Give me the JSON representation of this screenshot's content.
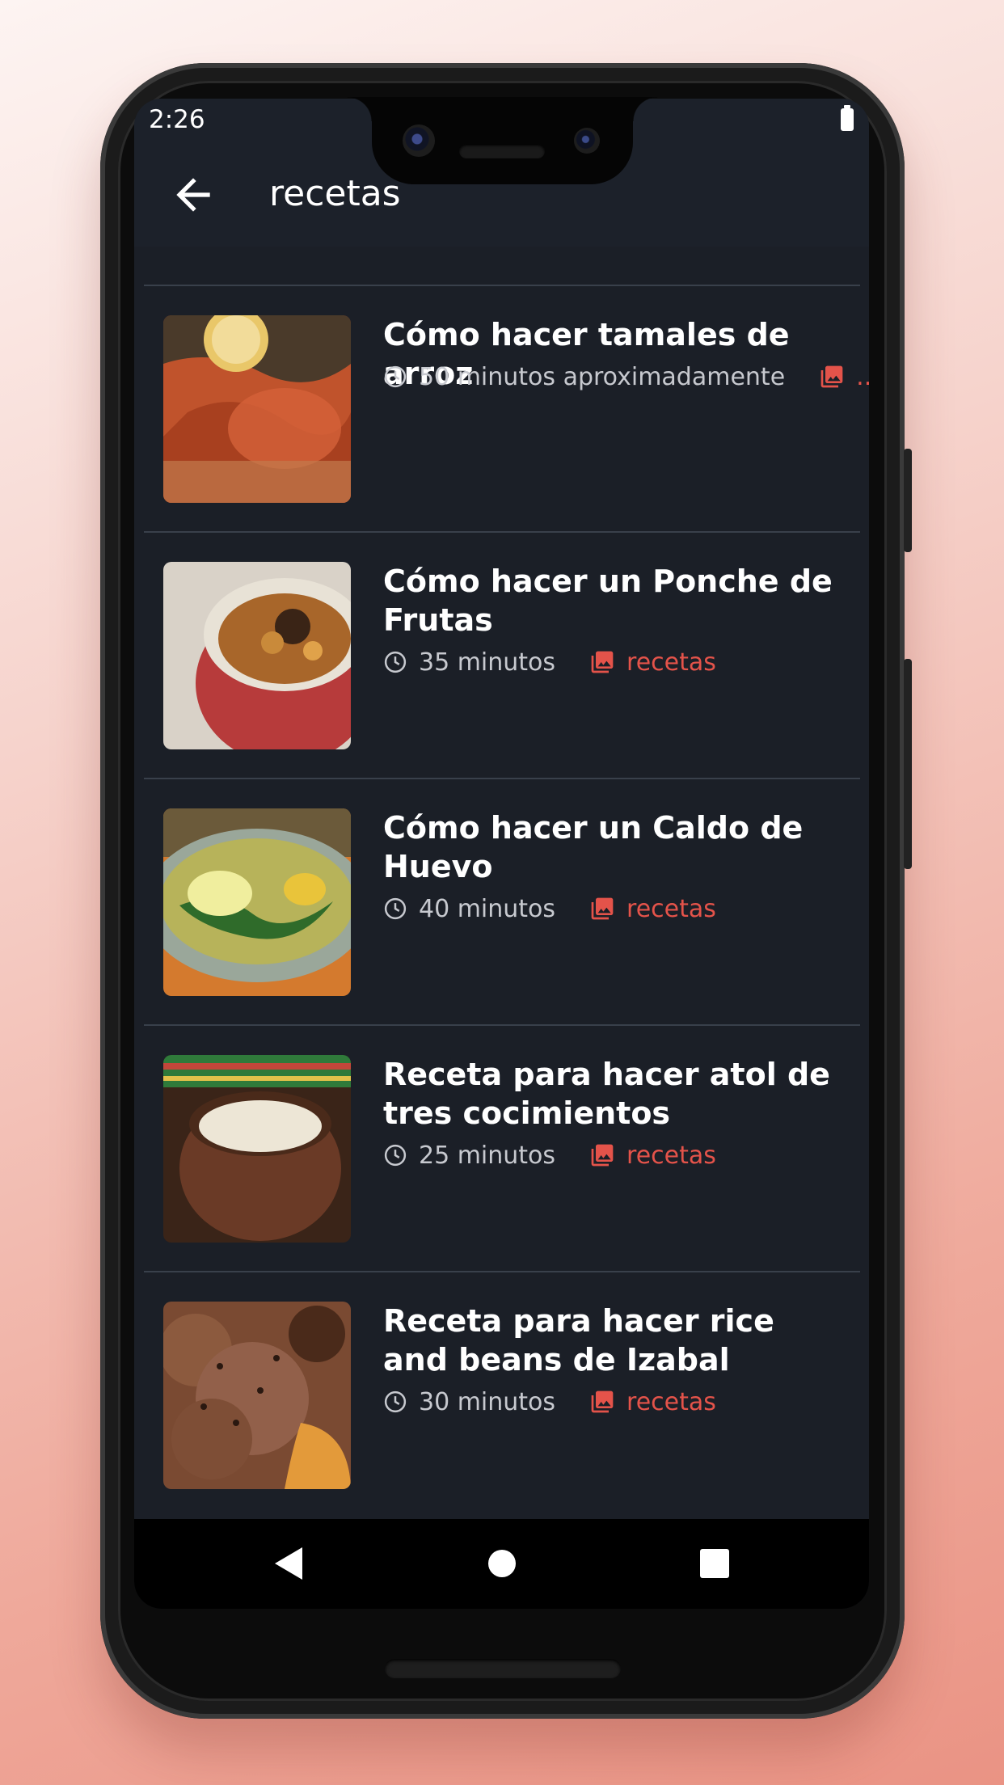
{
  "status_bar": {
    "time": "2:26"
  },
  "app_bar": {
    "title": "recetas"
  },
  "recipes": [
    {
      "title": "Cómo hacer tamales de arroz",
      "time": "50 minutos aproximadamente",
      "category": ".."
    },
    {
      "title": "Cómo hacer un Ponche de Frutas",
      "time": "35 minutos",
      "category": "recetas"
    },
    {
      "title": "Cómo hacer un Caldo de Huevo",
      "time": "40 minutos",
      "category": "recetas"
    },
    {
      "title": "Receta para hacer atol de tres cocimientos",
      "time": "25 minutos",
      "category": "recetas"
    },
    {
      "title": "Receta para hacer rice and beans de Izabal",
      "time": "30 minutos",
      "category": "recetas"
    }
  ],
  "colors": {
    "accent": "#e4534a",
    "background": "#1b1f27",
    "appbar": "#1c212a"
  },
  "icons": {
    "back": "arrow-left-icon",
    "time": "clock-icon",
    "category": "gallery-icon"
  }
}
